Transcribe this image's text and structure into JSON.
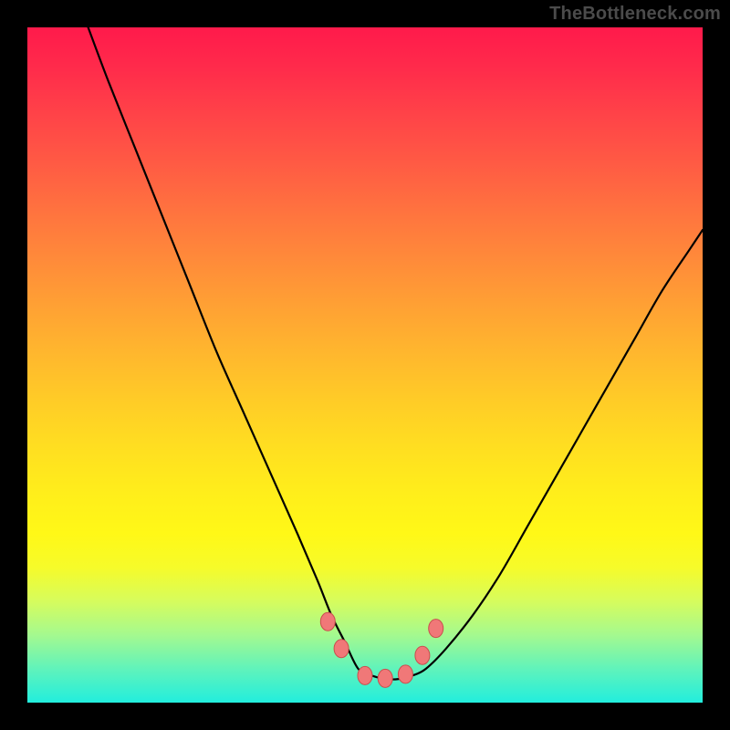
{
  "watermark": "TheBottleneck.com",
  "colors": {
    "frame": "#000000",
    "curve_stroke": "#000000",
    "marker_fill": "#f07878",
    "marker_stroke": "#c94e4e",
    "gradient_top": "#ff1a4b",
    "gradient_bottom": "#22eedd"
  },
  "chart_data": {
    "type": "line",
    "title": "",
    "xlabel": "",
    "ylabel": "",
    "xlim": [
      0,
      100
    ],
    "ylim": [
      0,
      100
    ],
    "note": "Axes unlabeled; x and values are in percent of plot width/height. values = height from bottom (0 = bottom, 100 = top).",
    "series": [
      {
        "name": "curve",
        "x": [
          9,
          12,
          16,
          20,
          24,
          28,
          32,
          36,
          40,
          43,
          45,
          47,
          49,
          51,
          53,
          55,
          57,
          59,
          62,
          66,
          70,
          74,
          78,
          82,
          86,
          90,
          94,
          98,
          100
        ],
        "values": [
          100,
          92,
          82,
          72,
          62,
          52,
          43,
          34,
          25,
          18,
          13,
          9,
          5,
          4,
          3.5,
          3.5,
          4,
          5,
          8,
          13,
          19,
          26,
          33,
          40,
          47,
          54,
          61,
          67,
          70
        ]
      }
    ],
    "markers": {
      "name": "trough-markers",
      "x": [
        44.5,
        46.5,
        50,
        53,
        56,
        58.5,
        60.5
      ],
      "values": [
        12,
        8,
        4,
        3.6,
        4.2,
        7,
        11
      ]
    }
  }
}
